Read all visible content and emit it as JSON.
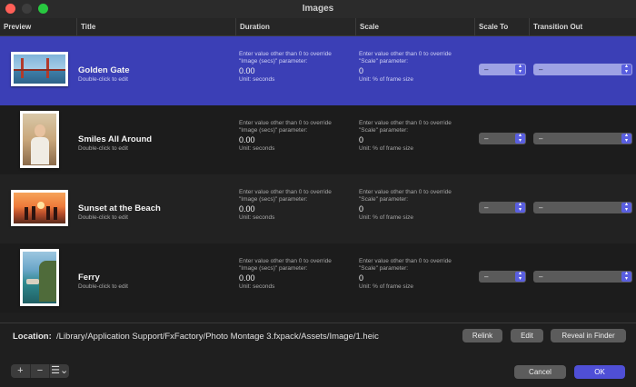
{
  "window": {
    "title": "Images"
  },
  "columns": {
    "preview": "Preview",
    "title": "Title",
    "duration": "Duration",
    "scale": "Scale",
    "scale_to": "Scale To",
    "transition_out": "Transition Out"
  },
  "rows": [
    {
      "title": "Golden Gate",
      "subtitle": "Double-click to edit",
      "duration_hint": "Enter value other than 0 to override \"Image (secs)\" parameter:",
      "duration_value": "0.00",
      "duration_unit": "Unit: seconds",
      "scale_hint": "Enter value other than 0 to override \"Scale\" parameter:",
      "scale_value": "0",
      "scale_unit": "Unit: % of frame size",
      "scale_to": "–",
      "transition_out": "–",
      "selected": true,
      "thumbnail": "bridge-photo"
    },
    {
      "title": "Smiles All Around",
      "subtitle": "Double-click to edit",
      "duration_hint": "Enter value other than 0 to override \"Image (secs)\" parameter:",
      "duration_value": "0.00",
      "duration_unit": "Unit: seconds",
      "scale_hint": "Enter value other than 0 to override \"Scale\" parameter:",
      "scale_value": "0",
      "scale_unit": "Unit: % of frame size",
      "scale_to": "–",
      "transition_out": "–",
      "selected": false,
      "thumbnail": "portrait-photo"
    },
    {
      "title": "Sunset at the Beach",
      "subtitle": "Double-click to edit",
      "duration_hint": "Enter value other than 0 to override \"Image (secs)\" parameter:",
      "duration_value": "0.00",
      "duration_unit": "Unit: seconds",
      "scale_hint": "Enter value other than 0 to override \"Scale\" parameter:",
      "scale_value": "0",
      "scale_unit": "Unit: % of frame size",
      "scale_to": "–",
      "transition_out": "–",
      "selected": false,
      "thumbnail": "sunset-photo"
    },
    {
      "title": "Ferry",
      "subtitle": "Double-click to edit",
      "duration_hint": "Enter value other than 0 to override \"Image (secs)\" parameter:",
      "duration_value": "0.00",
      "duration_unit": "Unit: seconds",
      "scale_hint": "Enter value other than 0 to override \"Scale\" parameter:",
      "scale_value": "0",
      "scale_unit": "Unit: % of frame size",
      "scale_to": "–",
      "transition_out": "–",
      "selected": false,
      "thumbnail": "coast-photo"
    }
  ],
  "location": {
    "label": "Location:",
    "path": "/Library/Application Support/FxFactory/Photo Montage 3.fxpack/Assets/Image/1.heic"
  },
  "buttons": {
    "relink": "Relink",
    "edit": "Edit",
    "reveal": "Reveal in Finder",
    "cancel": "Cancel",
    "ok": "OK",
    "add": "+",
    "remove": "−",
    "list": "☰⌄"
  },
  "colors": {
    "selection": "#3b3fb6",
    "accent": "#4f4fd6",
    "background": "#1f1f1f"
  }
}
